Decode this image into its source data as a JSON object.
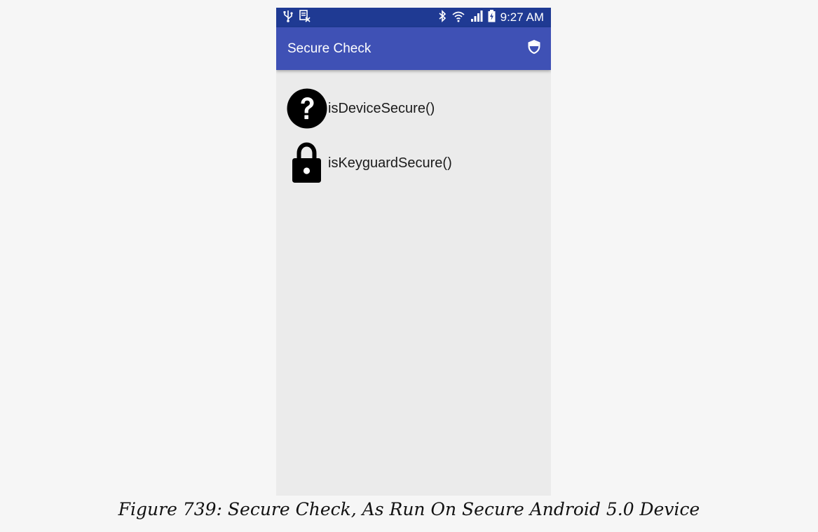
{
  "status_bar": {
    "time": "9:27 AM",
    "left_icons": [
      "usb-icon",
      "screenshot-notification-icon"
    ],
    "right_icons": [
      "bluetooth-icon",
      "wifi-icon",
      "signal-icon",
      "battery-icon"
    ]
  },
  "app_bar": {
    "title": "Secure Check",
    "action_icon": "shield-icon",
    "color": "#3f51b5",
    "status_color": "#1f3a93"
  },
  "checks": [
    {
      "label": "isDeviceSecure()",
      "icon": "help-circle-icon"
    },
    {
      "label": "isKeyguardSecure()",
      "icon": "lock-icon"
    }
  ],
  "caption": "Figure 739: Secure Check, As Run On Secure Android 5.0 Device"
}
